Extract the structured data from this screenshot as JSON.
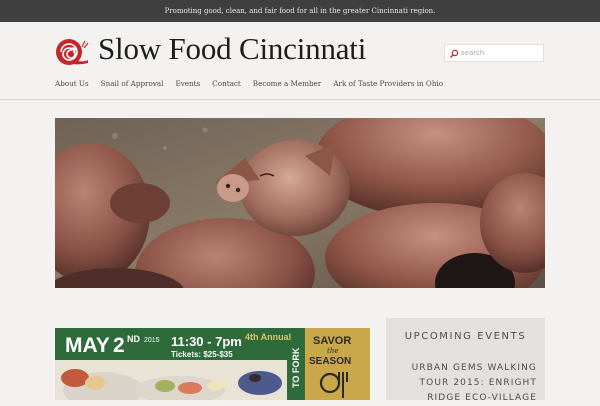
{
  "topbar": {
    "tagline": "Promoting good, clean, and fair food for all in the greater Cincinnati region."
  },
  "header": {
    "site_title": "Slow Food Cincinnati",
    "logo_icon": "snail-logo-icon"
  },
  "search": {
    "placeholder": "search",
    "value": ""
  },
  "nav": {
    "items": [
      {
        "label": "About Us"
      },
      {
        "label": "Snail of Approval"
      },
      {
        "label": "Events"
      },
      {
        "label": "Contact"
      },
      {
        "label": "Become a Member"
      },
      {
        "label": "Ark of Taste Providers in Ohio"
      }
    ]
  },
  "hero": {
    "image_subject": "pigs-photo"
  },
  "promo": {
    "date_month": "MAY",
    "date_day": "2",
    "date_suffix": "ND",
    "year": "2015",
    "time": "11:30 - 7pm",
    "edition": "4th Annual",
    "tickets": "Tickets: $25-$35",
    "side_text": "TO FORK",
    "savor": "SAVOR",
    "the": "the",
    "season": "SEASON"
  },
  "sidebar": {
    "title": "UPCOMING EVENTS",
    "event_link": "URBAN GEMS WALKING TOUR 2015: ENRIGHT RIDGE ECO-VILLAGE"
  },
  "colors": {
    "topbar_bg": "#3f3f3f",
    "page_bg": "#f3f2f0",
    "logo_red": "#c4262e",
    "promo_green": "#2f6a3a",
    "promo_gold": "#c9a84a",
    "sidebar_bg": "#e3e1de"
  }
}
